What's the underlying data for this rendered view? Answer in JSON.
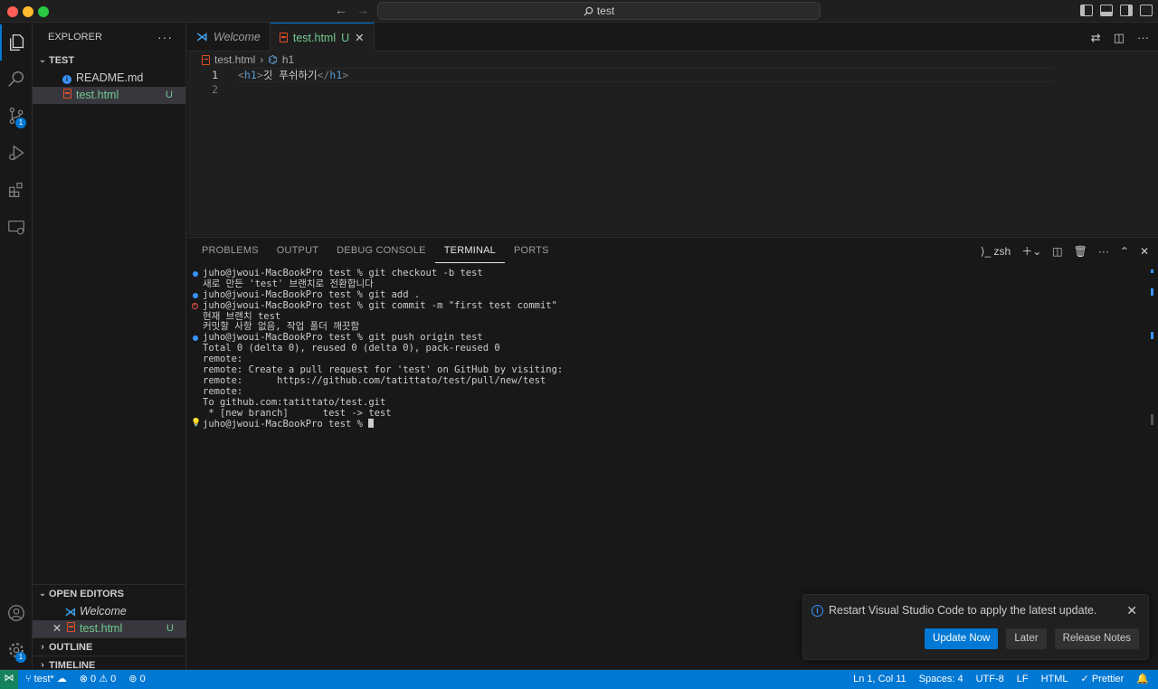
{
  "titlebar": {
    "search_text": "test"
  },
  "activity": {
    "scm_badge": "1",
    "settings_badge": "1"
  },
  "explorer": {
    "title": "EXPLORER",
    "more": "···",
    "folder": "TEST",
    "files": [
      {
        "name": "README.md",
        "status": ""
      },
      {
        "name": "test.html",
        "status": "U"
      }
    ],
    "open_editors_title": "OPEN EDITORS",
    "open_editors": [
      {
        "name": "Welcome",
        "status": ""
      },
      {
        "name": "test.html",
        "status": "U"
      }
    ],
    "outline": "OUTLINE",
    "timeline": "TIMELINE"
  },
  "tabs": [
    {
      "label": "Welcome"
    },
    {
      "label": "test.html",
      "status": "U"
    }
  ],
  "breadcrumb": {
    "file": "test.html",
    "symbol": "h1"
  },
  "editor": {
    "lines": [
      {
        "num": "1",
        "open": "<h1>",
        "text": "깃 푸쉬하기",
        "close": "</h1>"
      },
      {
        "num": "2",
        "open": "",
        "text": "",
        "close": ""
      }
    ]
  },
  "panel": {
    "tabs": [
      "PROBLEMS",
      "OUTPUT",
      "DEBUG CONSOLE",
      "TERMINAL",
      "PORTS"
    ],
    "active_tab": "TERMINAL",
    "shell": "zsh"
  },
  "terminal": [
    {
      "mark": "blue",
      "text": "juho@jwoui-MacBookPro test % git checkout -b test"
    },
    {
      "mark": "",
      "text": "새로 만든 'test' 브랜치로 전환합니다"
    },
    {
      "mark": "blue",
      "text": "juho@jwoui-MacBookPro test % git add ."
    },
    {
      "mark": "error",
      "text": "juho@jwoui-MacBookPro test % git commit -m \"first test commit\""
    },
    {
      "mark": "",
      "text": "현재 브랜치 test"
    },
    {
      "mark": "",
      "text": "커밋할 사항 없음, 작업 폴더 깨끗함"
    },
    {
      "mark": "blue",
      "text": "juho@jwoui-MacBookPro test % git push origin test"
    },
    {
      "mark": "",
      "text": "Total 0 (delta 0), reused 0 (delta 0), pack-reused 0"
    },
    {
      "mark": "",
      "text": "remote:"
    },
    {
      "mark": "",
      "text": "remote: Create a pull request for 'test' on GitHub by visiting:"
    },
    {
      "mark": "",
      "text": "remote:      https://github.com/tatittato/test/pull/new/test"
    },
    {
      "mark": "",
      "text": "remote:"
    },
    {
      "mark": "",
      "text": "To github.com:tatittato/test.git"
    },
    {
      "mark": "",
      "text": " * [new branch]      test -> test"
    },
    {
      "mark": "bulb",
      "text": "juho@jwoui-MacBookPro test % "
    }
  ],
  "notification": {
    "message": "Restart Visual Studio Code to apply the latest update.",
    "buttons": [
      "Update Now",
      "Later",
      "Release Notes"
    ]
  },
  "status": {
    "branch": "test*",
    "errors": "0",
    "warnings": "0",
    "ports": "0",
    "position": "Ln 1, Col 11",
    "spaces": "Spaces: 4",
    "encoding": "UTF-8",
    "eol": "LF",
    "language": "HTML",
    "formatter": "Prettier"
  }
}
